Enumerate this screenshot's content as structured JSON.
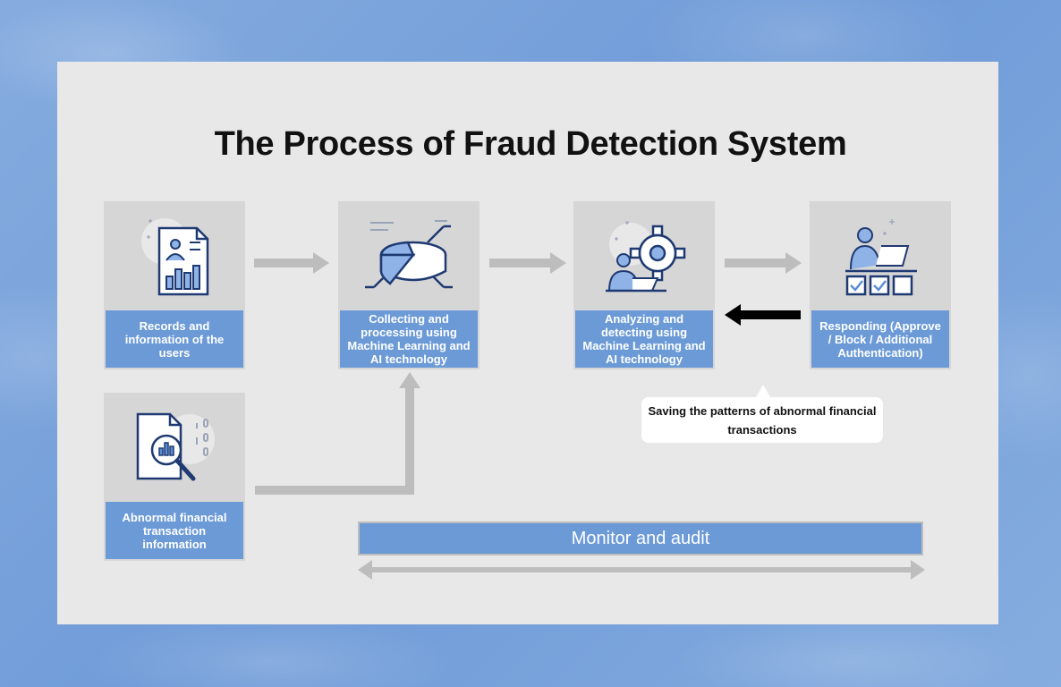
{
  "title": "The Process of Fraud Detection System",
  "nodes": {
    "records": "Records and information of the users",
    "collecting": "Collecting and processing using Machine Learning and AI technology",
    "analyzing": "Analyzing and detecting using Machine Learning and AI technology",
    "responding": "Responding (Approve / Block / Additional Authentication)",
    "abnormal": "Abnormal financial transaction information"
  },
  "callout": "Saving the patterns of abnormal financial transactions",
  "monitor": "Monitor and audit",
  "icons": {
    "records": "user-document-chart-icon",
    "collecting": "pie-chart-processing-icon",
    "analyzing": "gear-analyst-icon",
    "responding": "operator-checkbox-icon",
    "abnormal": "document-magnifier-icon"
  },
  "colors": {
    "background": "#7ea6de",
    "panel": "#e8e8e8",
    "card": "#d6d6d6",
    "label": "#6b9ad7",
    "icon_stroke": "#1f3a72",
    "arrow": "#bdbdbd",
    "feedback_arrow": "#000000"
  }
}
